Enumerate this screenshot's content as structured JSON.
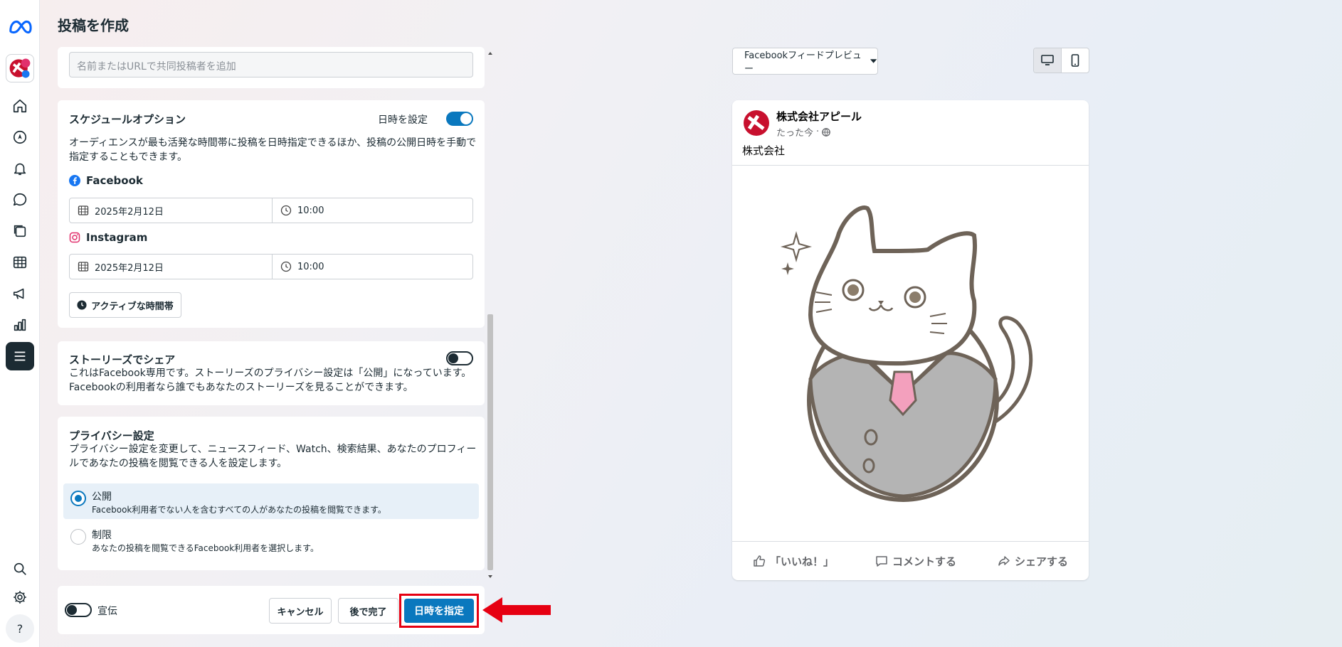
{
  "page": {
    "title": "投稿を作成"
  },
  "rail": {
    "icons": [
      "meta-logo-icon",
      "home-icon",
      "compass-icon",
      "bell-icon",
      "chat-icon",
      "content-icon",
      "table-icon",
      "megaphone-icon",
      "bar-chart-icon",
      "menu-icon",
      "search-icon",
      "gear-icon",
      "help-icon"
    ],
    "help_label": "?"
  },
  "collaborator": {
    "placeholder": "名前またはURLで共同投稿者を追加"
  },
  "schedule": {
    "title": "スケジュールオプション",
    "toggle_label": "日時を設定",
    "toggle_on": true,
    "description": "オーディエンスが最も活発な時間帯に投稿を日時指定できるほか、投稿の公開日時を手動で指定することもできます。",
    "facebook": {
      "label": "Facebook",
      "date": "2025年2月12日",
      "time": "10:00"
    },
    "instagram": {
      "label": "Instagram",
      "date": "2025年2月12日",
      "time": "10:00"
    },
    "active_times_button": "アクティブな時間帯"
  },
  "stories": {
    "title": "ストーリーズでシェア",
    "description": "これはFacebook専用です。ストーリーズのプライバシー設定は「公開」になっています。Facebookの利用者なら誰でもあなたのストーリーズを見ることができます。",
    "toggle_on": false
  },
  "privacy": {
    "title": "プライバシー設定",
    "description": "プライバシー設定を変更して、ニュースフィード、Watch、検索結果、あなたのプロフィールであなたの投稿を閲覧できる人を設定します。",
    "options": [
      {
        "label": "公開",
        "sub": "Facebook利用者でない人を含むすべての人があなたの投稿を閲覧できます。",
        "selected": true
      },
      {
        "label": "制限",
        "sub": "あなたの投稿を閲覧できるFacebook利用者を選択します。",
        "selected": false
      }
    ]
  },
  "footer": {
    "promo_label": "宣伝",
    "cancel": "キャンセル",
    "finish_later": "後で完了",
    "schedule": "日時を指定"
  },
  "preview": {
    "select_label": "Facebookフィードプレビュー",
    "page_name": "株式会社アピール",
    "time": "たった今",
    "text": "株式会社",
    "actions": [
      "「いいね！」",
      "コメントする",
      "シェアする"
    ]
  },
  "colors": {
    "accent": "#0a78be",
    "highlight": "#e60012"
  }
}
